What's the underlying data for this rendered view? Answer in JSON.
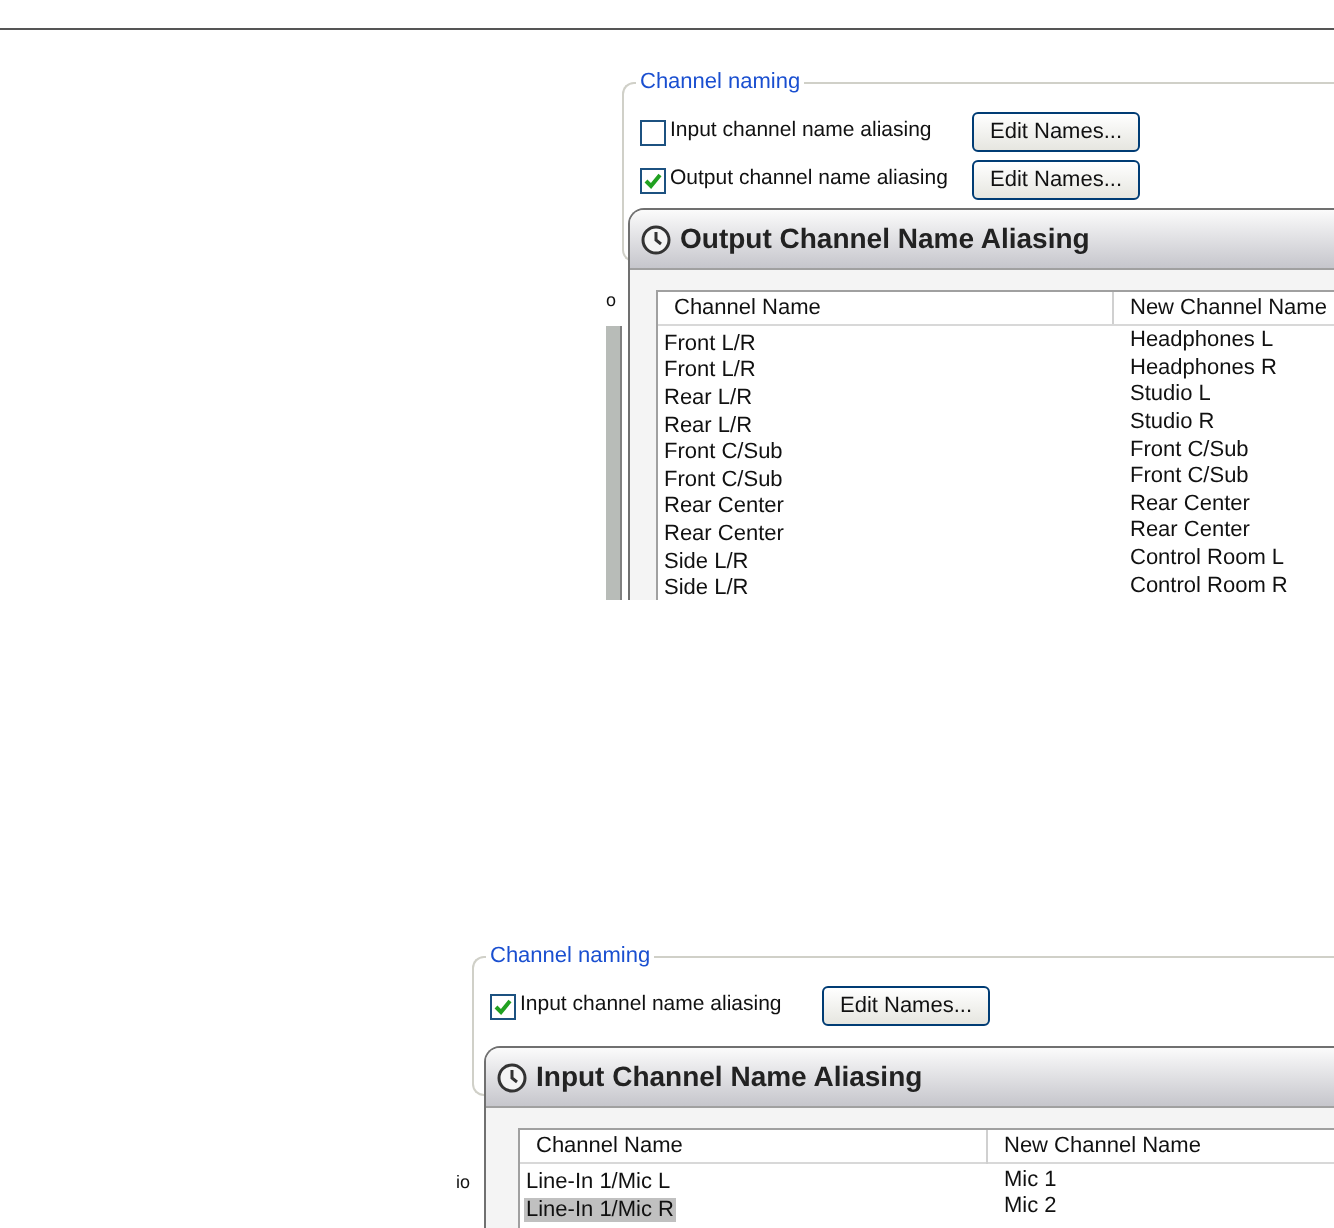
{
  "figures": [
    {
      "side_text": "o",
      "group_title": "Channel naming",
      "options": [
        {
          "label": "Input channel name aliasing",
          "checked": false,
          "button": "Edit Names..."
        },
        {
          "label": "Output channel name aliasing",
          "checked": true,
          "button": "Edit Names..."
        }
      ],
      "dialog": {
        "title": "Output Channel Name Aliasing",
        "columns": [
          "Channel Name",
          "New Channel Name"
        ],
        "rows": [
          {
            "cells": [
              "Front L/R",
              "Headphones L"
            ],
            "selected": false
          },
          {
            "cells": [
              "Front L/R",
              "Headphones R"
            ],
            "selected": false
          },
          {
            "cells": [
              "Rear L/R",
              "Studio L"
            ],
            "selected": false
          },
          {
            "cells": [
              "Rear L/R",
              "Studio R"
            ],
            "selected": false
          },
          {
            "cells": [
              "Front C/Sub",
              "Front C/Sub"
            ],
            "selected": false
          },
          {
            "cells": [
              "Front C/Sub",
              "Front C/Sub"
            ],
            "selected": false
          },
          {
            "cells": [
              "Rear Center",
              "Rear Center"
            ],
            "selected": false
          },
          {
            "cells": [
              "Rear Center",
              "Rear Center"
            ],
            "selected": false
          },
          {
            "cells": [
              "Side L/R",
              "Control Room L"
            ],
            "selected": false
          },
          {
            "cells": [
              "Side L/R",
              "Control Room R"
            ],
            "selected": false
          }
        ]
      }
    },
    {
      "side_text": "io",
      "group_title": "Channel naming",
      "options": [
        {
          "label": "Input channel name aliasing",
          "checked": true,
          "button": "Edit Names..."
        }
      ],
      "dialog": {
        "title": "Input Channel Name Aliasing",
        "columns": [
          "Channel Name",
          "New Channel Name"
        ],
        "rows": [
          {
            "cells": [
              "Line-In 1/Mic L",
              "Mic 1"
            ],
            "selected": false
          },
          {
            "cells": [
              "Line-In 1/Mic R",
              "Mic 2"
            ],
            "selected": true
          }
        ]
      }
    }
  ]
}
